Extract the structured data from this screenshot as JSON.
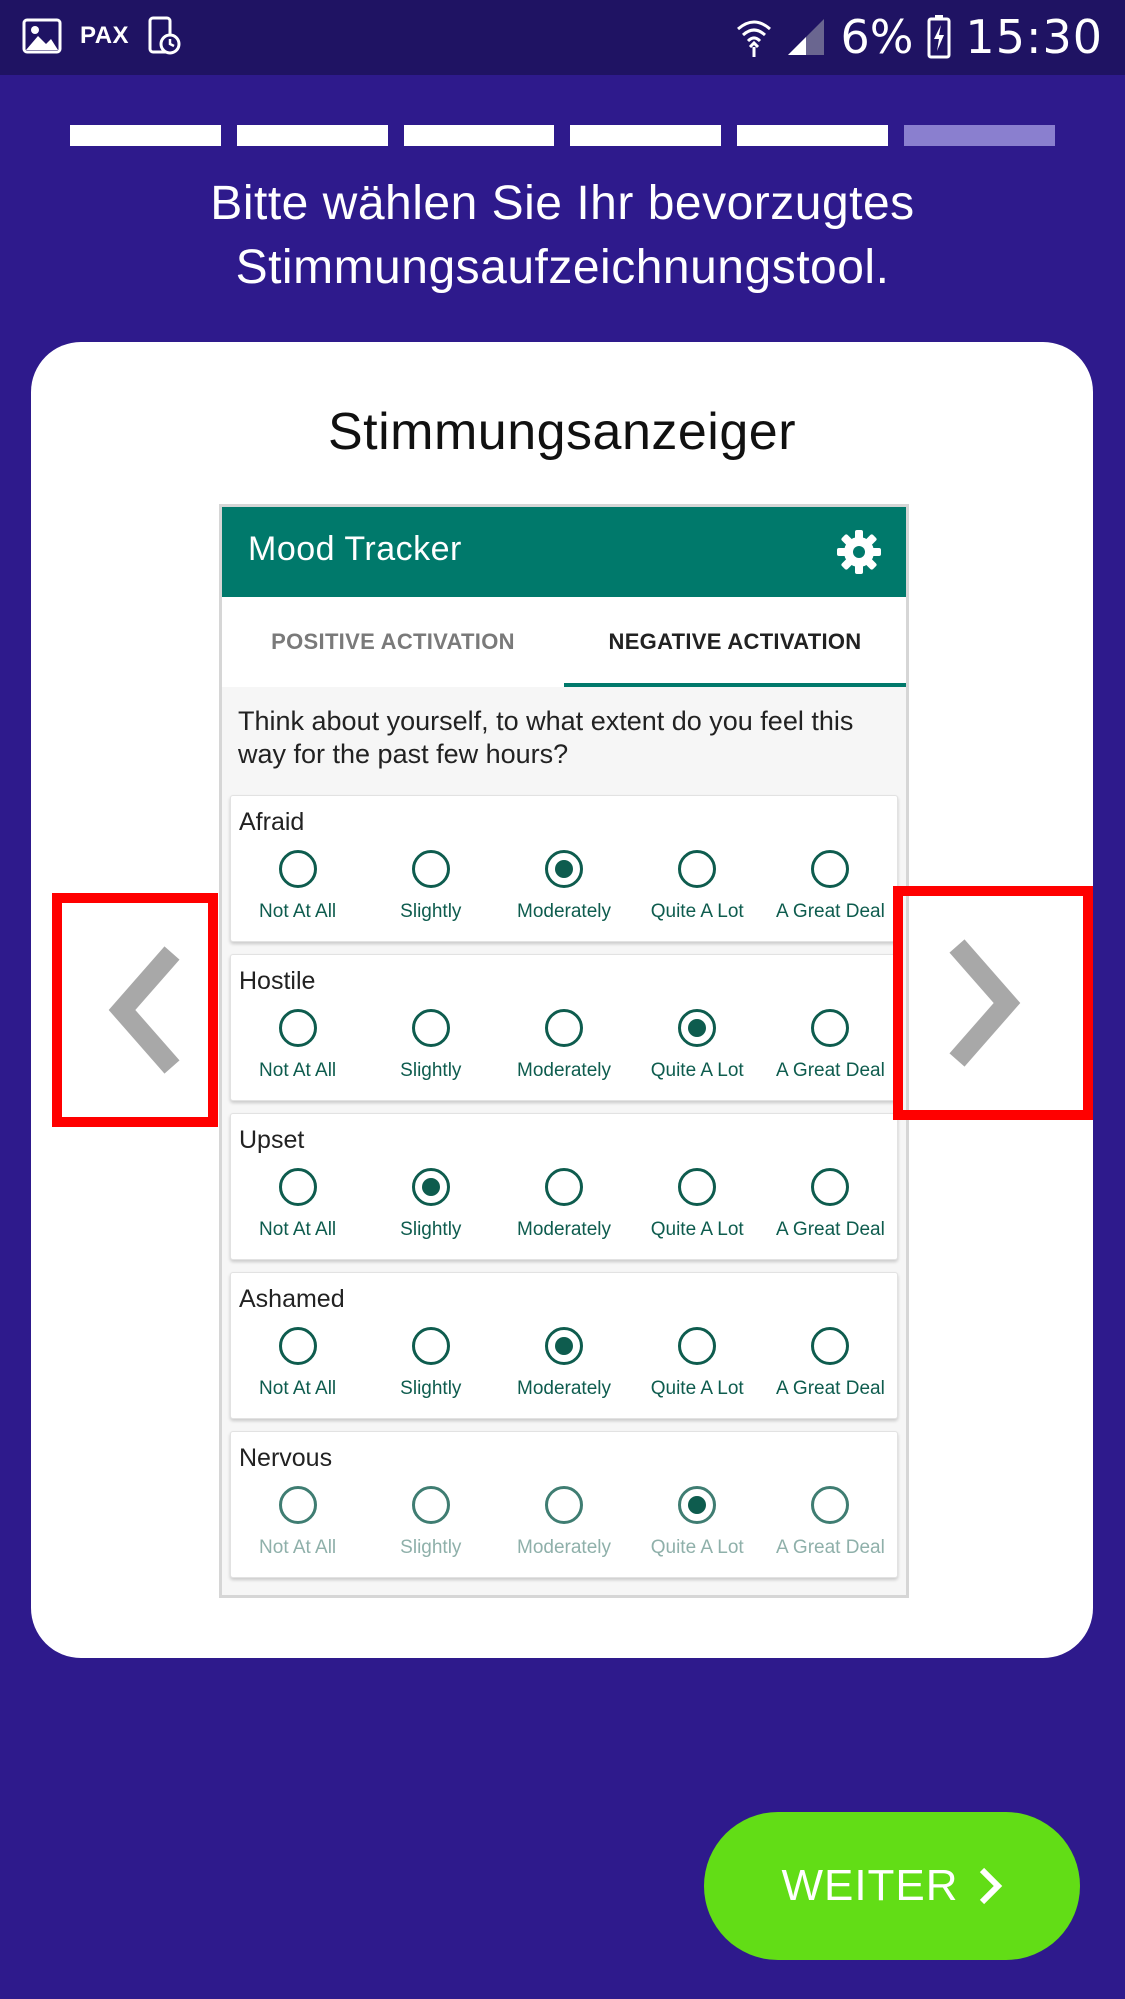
{
  "status_bar": {
    "left_text": "PAX",
    "battery": "6%",
    "time": "15:30"
  },
  "progress": {
    "total_steps": 6,
    "completed_steps": 5
  },
  "instruction": "Bitte wählen Sie Ihr bevorzugtes Stimmungsaufzeichnungstool.",
  "card": {
    "title": "Stimmungsanzeiger",
    "preview": {
      "app_title": "Mood Tracker",
      "tabs": [
        {
          "label": "POSITIVE ACTIVATION",
          "active": false
        },
        {
          "label": "NEGATIVE ACTIVATION",
          "active": true
        }
      ],
      "question": "Think about yourself, to what extent do you feel this way for the past few hours?",
      "options": [
        "Not At All",
        "Slightly",
        "Moderately",
        "Quite A Lot",
        "A Great Deal"
      ],
      "items": [
        {
          "label": "Afraid",
          "selected": 2
        },
        {
          "label": "Hostile",
          "selected": 3
        },
        {
          "label": "Upset",
          "selected": 1
        },
        {
          "label": "Ashamed",
          "selected": 2
        },
        {
          "label": "Nervous",
          "selected": 3
        }
      ]
    }
  },
  "next_button": {
    "label": "WEITER"
  },
  "colors": {
    "background": "#2e1a8c",
    "status_bar": "#1f1363",
    "teal": "#00796b",
    "button_green": "#62dd16",
    "highlight_red": "#ff0000"
  },
  "icons": {
    "prev": "chevron-left-icon",
    "next": "chevron-right-icon",
    "settings": "gear-icon"
  }
}
